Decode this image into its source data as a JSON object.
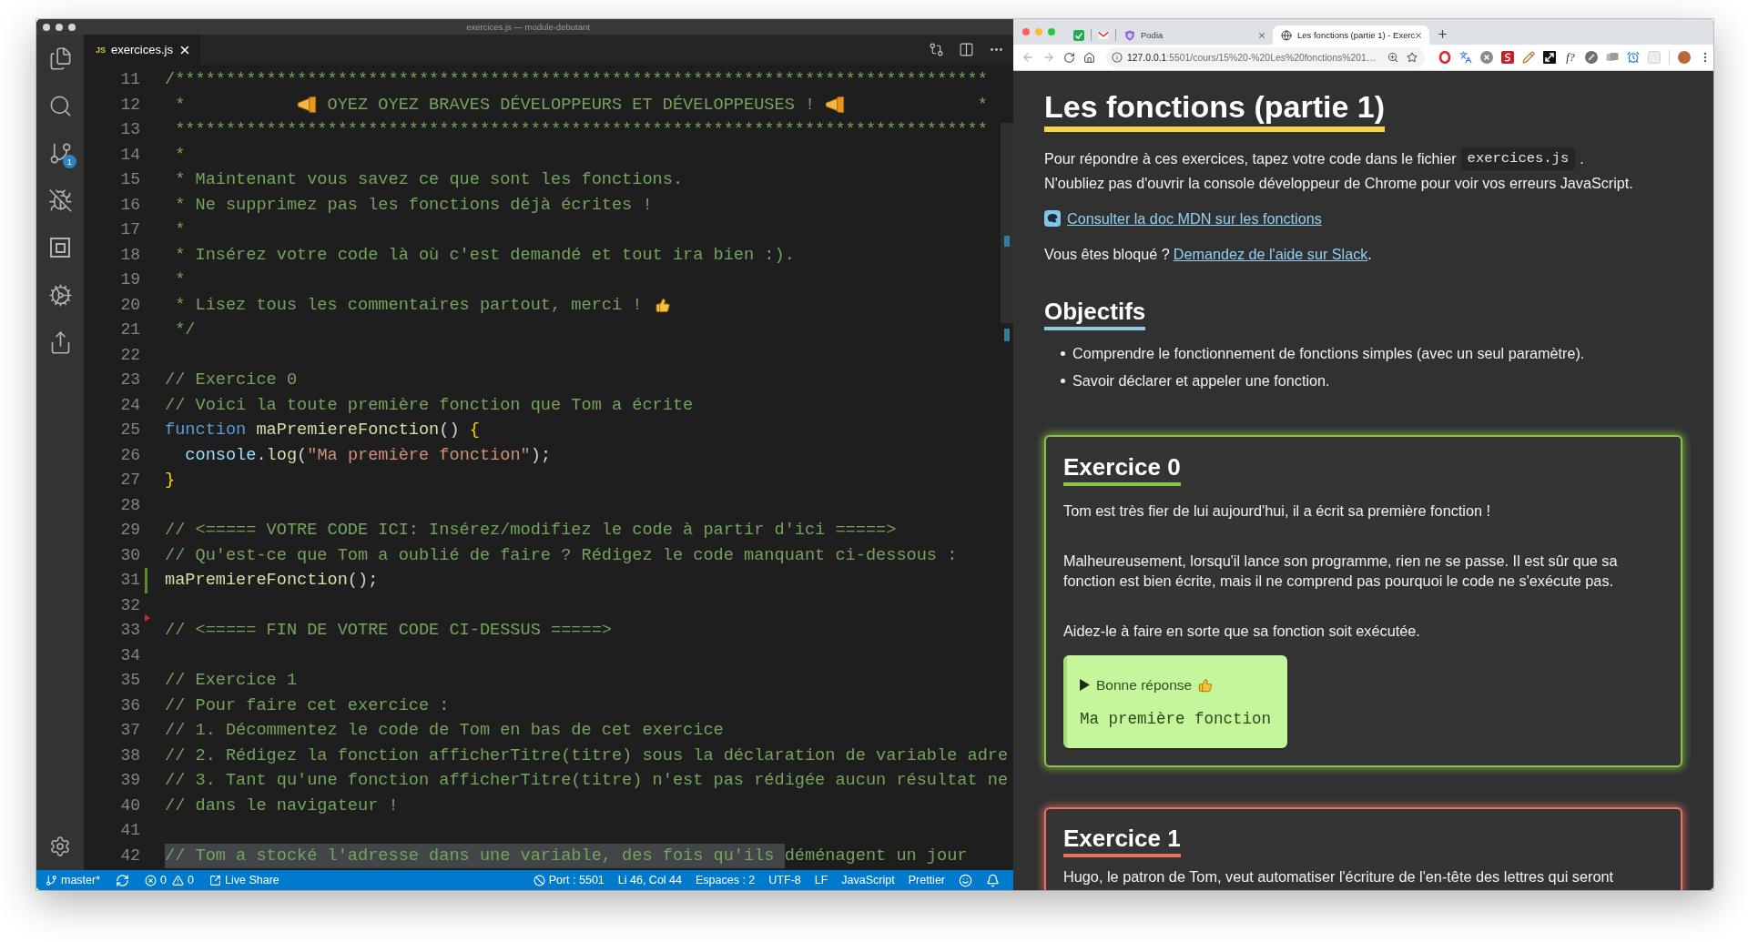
{
  "vscode": {
    "title": "exercices.js — module-debutant",
    "source_control_badge": "1",
    "tab": {
      "language": "JS",
      "filename": "exercices.js"
    },
    "lines": [
      {
        "number": "11",
        "kind": "plain",
        "tokens": [
          {
            "kind": "comment",
            "text": "/********************************************************************************"
          }
        ]
      },
      {
        "number": "12",
        "kind": "plain",
        "tokens": [
          {
            "kind": "comment",
            "text": " *           "
          },
          {
            "kind": "horn"
          },
          {
            "kind": "comment",
            "text": " OYEZ OYEZ BRAVES DÉVELOPPEURS ET DÉVELOPPEUSES ! "
          },
          {
            "kind": "horn"
          },
          {
            "kind": "comment",
            "text": "             *"
          }
        ]
      },
      {
        "number": "13",
        "kind": "plain",
        "tokens": [
          {
            "kind": "comment",
            "text": " ********************************************************************************"
          }
        ]
      },
      {
        "number": "14",
        "kind": "plain",
        "tokens": [
          {
            "kind": "comment",
            "text": " *"
          }
        ]
      },
      {
        "number": "15",
        "kind": "plain",
        "tokens": [
          {
            "kind": "comment",
            "text": " * Maintenant vous savez ce que sont les fonctions."
          }
        ]
      },
      {
        "number": "16",
        "kind": "plain",
        "tokens": [
          {
            "kind": "comment",
            "text": " * Ne supprimez pas les fonctions déjà écrites !"
          }
        ]
      },
      {
        "number": "17",
        "kind": "plain",
        "tokens": [
          {
            "kind": "comment",
            "text": " *"
          }
        ]
      },
      {
        "number": "18",
        "kind": "plain",
        "tokens": [
          {
            "kind": "comment",
            "text": " * Insérez votre code là où c'est demandé et tout ira bien :)."
          }
        ]
      },
      {
        "number": "19",
        "kind": "plain",
        "tokens": [
          {
            "kind": "comment",
            "text": " *"
          }
        ]
      },
      {
        "number": "20",
        "kind": "plain",
        "tokens": [
          {
            "kind": "comment",
            "text": " * Lisez tous les commentaires partout, merci ! "
          },
          {
            "kind": "thumb"
          }
        ]
      },
      {
        "number": "21",
        "kind": "plain",
        "tokens": [
          {
            "kind": "comment",
            "text": " */"
          }
        ]
      },
      {
        "number": "22",
        "kind": "plain"
      },
      {
        "number": "23",
        "kind": "plain",
        "tokens": [
          {
            "kind": "comment",
            "text": "// Exercice 0"
          }
        ]
      },
      {
        "number": "24",
        "kind": "plain",
        "tokens": [
          {
            "kind": "comment",
            "text": "// Voici la toute première fonction que Tom a écrite"
          }
        ]
      },
      {
        "number": "25",
        "kind": "plain",
        "tokens": [
          {
            "kind": "keyword",
            "text": "function "
          },
          {
            "kind": "function",
            "text": "maPremiereFonction"
          },
          {
            "kind": "punct",
            "text": "() "
          },
          {
            "kind": "bracket",
            "text": "{"
          }
        ]
      },
      {
        "number": "26",
        "kind": "plain",
        "tokens": [
          {
            "kind": "variable",
            "text": "  console"
          },
          {
            "kind": "punct",
            "text": "."
          },
          {
            "kind": "function",
            "text": "log"
          },
          {
            "kind": "punct",
            "text": "("
          },
          {
            "kind": "string",
            "text": "\"Ma première fonction\""
          },
          {
            "kind": "punct",
            "text": ");"
          }
        ]
      },
      {
        "number": "27",
        "kind": "plain",
        "tokens": [
          {
            "kind": "bracket",
            "text": "}"
          }
        ]
      },
      {
        "number": "28",
        "kind": "plain"
      },
      {
        "number": "29",
        "kind": "plain",
        "tokens": [
          {
            "kind": "comment",
            "text": "// <===== VOTRE CODE ICI: Insérez/modifiez le code à partir d'ici =====>"
          }
        ]
      },
      {
        "number": "30",
        "kind": "plain",
        "tokens": [
          {
            "kind": "comment",
            "text": "// Qu'est-ce que Tom a oublié de faire ? Rédigez le code manquant ci-dessous :"
          }
        ]
      },
      {
        "number": "31",
        "kind": "added",
        "tokens": [
          {
            "kind": "function",
            "text": "maPremiereFonction"
          },
          {
            "kind": "punct",
            "text": "();"
          }
        ]
      },
      {
        "number": "32",
        "kind": "plain"
      },
      {
        "number": "33",
        "kind": "deleted",
        "tokens": [
          {
            "kind": "comment",
            "text": "// <===== FIN DE VOTRE CODE CI-DESSUS =====>"
          }
        ]
      },
      {
        "number": "34",
        "kind": "plain"
      },
      {
        "number": "35",
        "kind": "plain",
        "tokens": [
          {
            "kind": "comment",
            "text": "// Exercice 1"
          }
        ]
      },
      {
        "number": "36",
        "kind": "plain",
        "tokens": [
          {
            "kind": "comment",
            "text": "// Pour faire cet exercice :"
          }
        ]
      },
      {
        "number": "37",
        "kind": "plain",
        "tokens": [
          {
            "kind": "comment",
            "text": "// 1. Décommentez le code de Tom en bas de cet exercice"
          }
        ]
      },
      {
        "number": "38",
        "kind": "plain",
        "tokens": [
          {
            "kind": "comment",
            "text": "// 2. Rédigez la fonction afficherTitre(titre) sous la déclaration de variable adre"
          }
        ]
      },
      {
        "number": "39",
        "kind": "plain",
        "tokens": [
          {
            "kind": "comment",
            "text": "// 3. Tant qu'une fonction afficherTitre(titre) n'est pas rédigée aucun résultat ne"
          }
        ]
      },
      {
        "number": "40",
        "kind": "plain",
        "tokens": [
          {
            "kind": "comment",
            "text": "// dans le navigateur !"
          }
        ]
      },
      {
        "number": "41",
        "kind": "plain"
      },
      {
        "number": "42",
        "kind": "plain",
        "tokens": [
          {
            "kind": "selection",
            "text": "// Tom a stocké l'adresse dans une variable, des fois qu'ils "
          },
          {
            "kind": "comment",
            "text": "déménagent un jour"
          }
        ]
      }
    ],
    "status_bar": {
      "left": [
        {
          "kind": "branch",
          "text": "master*"
        },
        {
          "kind": "sync"
        },
        {
          "kind": "errors",
          "text": "0"
        },
        {
          "kind": "warnings",
          "text": "0"
        },
        {
          "kind": "liveshare",
          "text": "Live Share"
        }
      ],
      "right": [
        {
          "kind": "port",
          "text": "Port : 5501"
        },
        {
          "kind": "text",
          "text": "Li 46, Col 44"
        },
        {
          "kind": "text",
          "text": "Espaces : 2"
        },
        {
          "kind": "text",
          "text": "UTF-8"
        },
        {
          "kind": "text",
          "text": "LF"
        },
        {
          "kind": "text",
          "text": "JavaScript"
        },
        {
          "kind": "text",
          "text": "Prettier"
        },
        {
          "kind": "feedback"
        },
        {
          "kind": "bell"
        }
      ]
    }
  },
  "browser": {
    "tabs": [
      {
        "kind": "check",
        "selected": false
      },
      {
        "kind": "mail",
        "selected": false
      },
      {
        "kind": "shield",
        "title": "Podia",
        "selected": false
      },
      {
        "kind": "globe",
        "title": "Les fonctions (partie 1) - Exerc",
        "selected": true
      }
    ],
    "address": {
      "host": "127.0.0.1",
      "path": ":5501/cours/15%20-%20Les%20fonctions%201…"
    },
    "extension_label": "f?",
    "page": {
      "title": "Les fonctions (partie 1)",
      "intro": {
        "text": "Pour répondre à ces exercices, tapez votre code dans le fichier",
        "code": "exercices.js",
        "end": ".",
        "note": "N'oubliez pas d'ouvrir la console développeur de Chrome pour voir vos erreurs JavaScript."
      },
      "doc_link": "Consulter la doc MDN sur les fonctions",
      "help": {
        "text": "Vous êtes bloqué ?",
        "link": "Demandez de l'aide sur Slack",
        "end": "."
      },
      "objectives": {
        "title": "Objectifs",
        "items": [
          "Comprendre le fonctionnement de fonctions simples (avec un seul paramètre).",
          "Savoir déclarer et appeler une fonction."
        ]
      },
      "exercises": [
        {
          "title": "Exercice 0",
          "color": "#8bc34a",
          "paragraphs": [
            "Tom est très fier de lui aujourd'hui, il a écrit sa première fonction !",
            "Malheureusement, lorsqu'il lance son programme, rien ne se passe. Il est sûr que sa fonction est bien écrite, mais il ne comprend pas pourquoi le code ne s'exécute pas.",
            "Aidez-le à faire en sorte que sa fonction soit exécutée."
          ],
          "answer": {
            "label": "Bonne réponse",
            "output": "Ma première fonction"
          }
        },
        {
          "title": "Exercice 1",
          "color": "#e57361",
          "paragraphs": [
            "Hugo, le patron de Tom, veut automatiser l'écriture de l'en-tête des lettres qui seront"
          ]
        }
      ]
    }
  }
}
